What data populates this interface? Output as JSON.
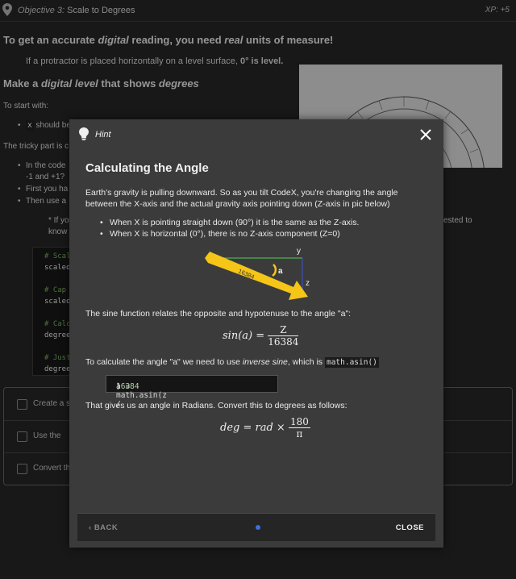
{
  "topbar": {
    "objective_prefix": "Objective 3:",
    "objective_title": "Scale to Degrees",
    "xp": "XP: +5"
  },
  "background": {
    "heading1_pre": "To get an accurate ",
    "heading1_em1": "digital",
    "heading1_mid": " reading, you need ",
    "heading1_em2": "real",
    "heading1_post": " units of measure!",
    "intro_pre": "If a protractor is placed horizontally on a level surface, ",
    "intro_bold": "0° is level.",
    "heading2_pre": "Make a ",
    "heading2_em1": "digital level",
    "heading2_mid": " that shows ",
    "heading2_em2": "degrees",
    "start_with": "To start with:",
    "bullet1_code": "x",
    "bullet1_text": " should be",
    "tricky": "The tricky part is c",
    "bullet2": "In the code",
    "bullet2b": "-1 and +1?",
    "bullet3": "First you ha",
    "bullet4": "Then use a",
    "note_left": "* If yo",
    "note_left2": "know",
    "note_right": "ested to",
    "code_lines": [
      "# Scal",
      "scaled",
      "# Cap",
      "scaled",
      "# Calc",
      "degree",
      "# Just",
      "degree"
    ],
    "tasks": [
      {
        "label": "Create a s"
      },
      {
        "label": "Use the "
      },
      {
        "label": "Convert th"
      }
    ]
  },
  "hint": {
    "label": "Hint",
    "title": "Calculating the Angle",
    "para1": "Earth's gravity is pulling downward. So as you tilt CodeX, you're changing the angle between the X-axis and the actual gravity axis pointing down (Z-axis in pic below)",
    "bullet1": "When X is pointing straight down (90°) it is the same as the Z-axis.",
    "bullet2": "When X is horizontal (0°), there is no Z-axis component (Z=0)",
    "diagram": {
      "y_label": "y",
      "z_label": "z",
      "a_label": "a",
      "arrow_label": "16384",
      "colors": {
        "arrow": "#f5c518",
        "y_axis": "#4caf50",
        "z_axis": "#3f51b5",
        "arc": "#f5c518"
      }
    },
    "para2": "The sine function relates the opposite and hypotenuse to the angle \"a\":",
    "eq1_lhs": "sin(a) =",
    "eq1_num": "Z",
    "eq1_den": "16384",
    "para3_pre": "To calculate the angle \"a\" we need to use ",
    "para3_em": "inverse sine",
    "para3_mid": ", which is ",
    "para3_code": "math.asin()",
    "code_pre": "a = math.asin(z / ",
    "code_num": "16384",
    "code_post": ")",
    "para4": "That gives us an angle in Radians. Convert this to degrees as follows:",
    "eq2_lhs": "deg = rad ×",
    "eq2_num": "180",
    "eq2_den": "π",
    "back_label": "BACK",
    "close_label": "CLOSE"
  }
}
